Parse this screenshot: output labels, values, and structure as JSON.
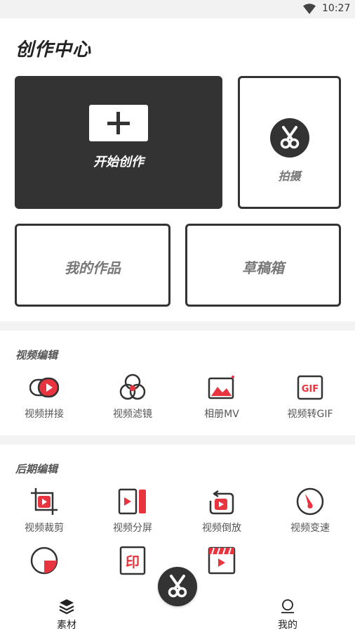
{
  "status_bar": {
    "time": "10:27"
  },
  "page_title": "创作中心",
  "cards": {
    "start": "开始创作",
    "shoot": "拍摄",
    "works": "我的作品",
    "drafts": "草稿箱"
  },
  "sections": {
    "video_edit": {
      "title": "视频编辑",
      "tools": [
        {
          "label": "视频拼接",
          "icon": "video-merge-icon"
        },
        {
          "label": "视频滤镜",
          "icon": "video-filter-icon"
        },
        {
          "label": "相册MV",
          "icon": "album-mv-icon"
        },
        {
          "label": "视频转GIF",
          "icon": "video-to-gif-icon"
        }
      ]
    },
    "post_edit": {
      "title": "后期编辑",
      "tools": [
        {
          "label": "视频裁剪",
          "icon": "video-crop-icon"
        },
        {
          "label": "视频分屏",
          "icon": "video-split-screen-icon"
        },
        {
          "label": "视频倒放",
          "icon": "video-reverse-icon"
        },
        {
          "label": "视频变速",
          "icon": "video-speed-icon"
        }
      ],
      "more_icons": [
        "clock-icon",
        "stamp-icon",
        "clapperboard-icon"
      ],
      "stamp_glyph": "印"
    }
  },
  "tab_bar": {
    "left": {
      "label": "素材",
      "icon": "layers-icon"
    },
    "right": {
      "label": "我的",
      "icon": "profile-icon"
    }
  },
  "colors": {
    "accent": "#e8343f",
    "dark": "#333333"
  }
}
